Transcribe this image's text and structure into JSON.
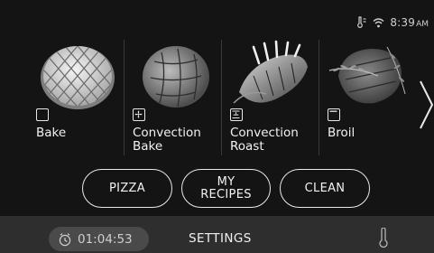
{
  "status_bar": {
    "time": "8:39",
    "ampm": "AM",
    "icons": [
      "probe-status-icon",
      "wifi-icon"
    ]
  },
  "modes": [
    {
      "label": "Bake",
      "icon": "bake-icon",
      "image": "lattice-pie"
    },
    {
      "label": "Convection\nBake",
      "icon": "convection-fan-icon",
      "image": "bread-loaf"
    },
    {
      "label": "Convection\nRoast",
      "icon": "convection-roast-icon",
      "image": "rack-of-lamb"
    },
    {
      "label": "Broil",
      "icon": "broil-icon",
      "image": "steak"
    }
  ],
  "buttons": {
    "pizza": "PIZZA",
    "my_recipes": "MY\nRECIPES",
    "clean": "CLEAN"
  },
  "bottom_bar": {
    "timer": "01:04:53",
    "settings": "SETTINGS"
  },
  "icons": {
    "next": "chevron-right-icon",
    "timer": "clock-icon",
    "probe": "meat-probe-icon"
  }
}
